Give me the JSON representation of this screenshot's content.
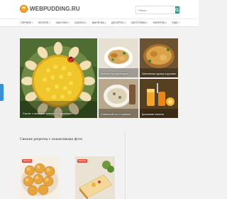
{
  "header": {
    "logo_text": "WEBPUDDING.RU",
    "search_placeholder": "Поиск ..."
  },
  "nav": {
    "items": [
      {
        "label": "Первое",
        "has_dropdown": true
      },
      {
        "label": "Второе",
        "has_dropdown": true
      },
      {
        "label": "Закуски",
        "has_dropdown": true
      },
      {
        "label": "Салаты",
        "has_dropdown": true
      },
      {
        "label": "Выпечка",
        "has_dropdown": true
      },
      {
        "label": "Десерты",
        "has_dropdown": true
      },
      {
        "label": "Заготовки",
        "has_dropdown": true
      },
      {
        "label": "Напитки",
        "has_dropdown": true
      },
      {
        "label": "Ещё",
        "has_dropdown": true
      }
    ]
  },
  "featured": {
    "hero_caption": "Салат с печенью трески «Подсолнух»",
    "tiles": [
      {
        "caption": "Минтай под маринадом"
      },
      {
        "caption": "Запеченная курица в духовке"
      },
      {
        "caption": "Сливочный суп с грибами"
      },
      {
        "caption": "Домашние напитки"
      }
    ]
  },
  "section": {
    "title": "Свежие рецепты с пошаговыми фото"
  },
  "cards": [
    {
      "badge": "Выпечка"
    },
    {
      "badge": "Выпечка"
    }
  ],
  "colors": {
    "accent": "#2f9e8f",
    "badge": "#e84c3d",
    "side_tab": "#3a8fd0",
    "background": "#f2f2f2"
  }
}
